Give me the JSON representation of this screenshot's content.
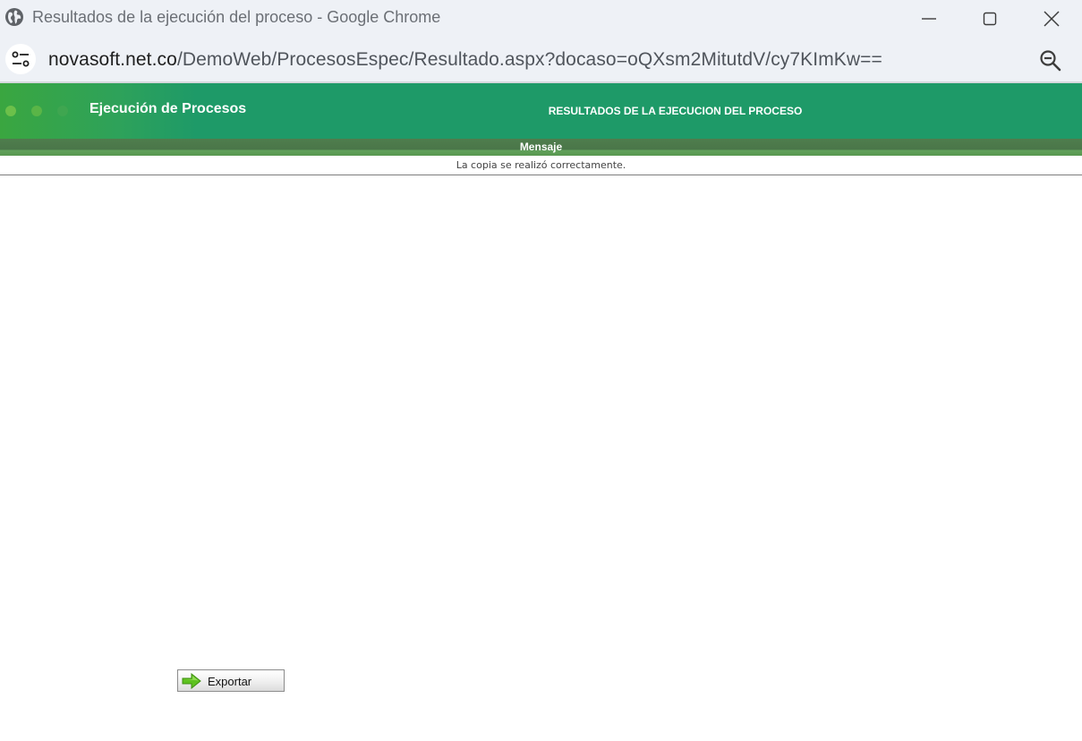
{
  "window": {
    "title": "Resultados de la ejecución del proceso - Google Chrome"
  },
  "addressbar": {
    "url_host": "novasoft.net.co",
    "url_path": "/DemoWeb/ProcesosEspec/Resultado.aspx?docaso=oQXsm2MitutdV/cy7KImKw=="
  },
  "app": {
    "title": "Ejecución de Procesos",
    "heading": "RESULTADOS DE LA EJECUCION DEL PROCESO"
  },
  "message": {
    "header": "Mensaje",
    "text": "La copia se realizó correctamente."
  },
  "actions": {
    "export_label": "Exportar"
  },
  "colors": {
    "header_green": "#1e9a68",
    "message_bar": "#4f7d4d",
    "export_arrow": "#5dc21e"
  },
  "icons": [
    "globe-icon",
    "minimize-icon",
    "maximize-icon",
    "close-icon",
    "site-settings-icon",
    "zoom-out-icon",
    "arrow-right-icon"
  ]
}
